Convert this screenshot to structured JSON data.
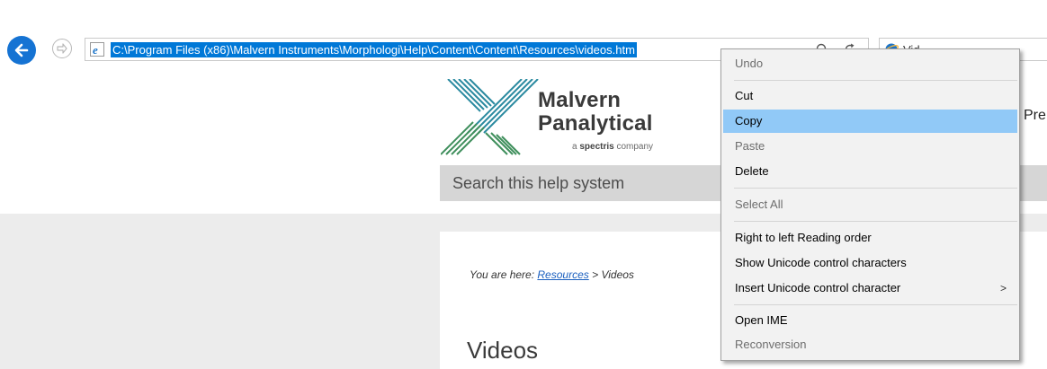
{
  "browser": {
    "address": "C:\\Program Files (x86)\\Malvern Instruments\\Morphologi\\Help\\Content\\Content\\Resources\\videos.htm",
    "tab_title": "Vid"
  },
  "page": {
    "logo_line1": "Malvern",
    "logo_line2": "Panalytical",
    "logo_tagline_prefix": "a ",
    "logo_tagline_brand": "spectris",
    "logo_tagline_suffix": " company",
    "header_link": "Pre",
    "search_placeholder": "Search this help system",
    "breadcrumb_prefix": "You are here: ",
    "breadcrumb_link": "Resources",
    "breadcrumb_sep": " > ",
    "breadcrumb_current": "Videos",
    "title": "Videos"
  },
  "context_menu": {
    "items": [
      {
        "label": "Undo",
        "enabled": false
      },
      {
        "label": "Cut",
        "enabled": true
      },
      {
        "label": "Copy",
        "enabled": true,
        "selected": true
      },
      {
        "label": "Paste",
        "enabled": false
      },
      {
        "label": "Delete",
        "enabled": true
      },
      {
        "label": "Select All",
        "enabled": false
      },
      {
        "label": "Right to left Reading order",
        "enabled": true
      },
      {
        "label": "Show Unicode control characters",
        "enabled": true
      },
      {
        "label": "Insert Unicode control character",
        "enabled": true,
        "submenu": true
      },
      {
        "label": "Open IME",
        "enabled": true
      },
      {
        "label": "Reconversion",
        "enabled": false
      }
    ],
    "submenu_arrow": ">"
  },
  "colors": {
    "back_button": "#1573d3",
    "address_selection": "#0078d7",
    "menu_highlight": "#91c9f7",
    "logo_green": "#3f8f5c",
    "logo_teal": "#2a8aa0"
  },
  "icons": [
    "back-arrow-icon",
    "forward-arrow-icon",
    "ie-icon",
    "search-icon",
    "refresh-icon",
    "malvern-logo-icon",
    "submenu-arrow-icon"
  ]
}
